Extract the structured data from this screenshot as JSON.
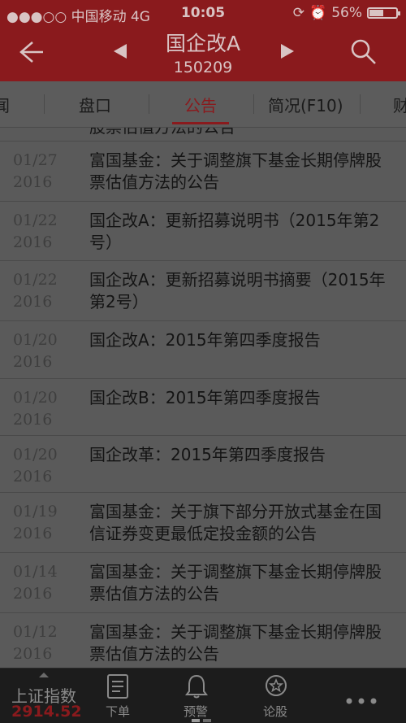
{
  "status_bar": {
    "carrier": "●●●○○ 中国移动  4G",
    "time": "10:05",
    "battery_percent": "56%",
    "battery_level": 0.56
  },
  "header": {
    "title": "国企改A",
    "code": "150209"
  },
  "tabs": [
    {
      "label": "闻",
      "active": false
    },
    {
      "label": "盘口",
      "active": false
    },
    {
      "label": "公告",
      "active": true
    },
    {
      "label": "简况(F10)",
      "active": false
    },
    {
      "label": "财",
      "active": false
    }
  ],
  "announcements": [
    {
      "date_md": "",
      "date_y": "",
      "title": "股票估值方法的公告"
    },
    {
      "date_md": "01/27",
      "date_y": "2016",
      "title": "富国基金：关于调整旗下基金长期停牌股票估值方法的公告"
    },
    {
      "date_md": "01/22",
      "date_y": "2016",
      "title": "国企改A：更新招募说明书（2015年第2号）"
    },
    {
      "date_md": "01/22",
      "date_y": "2016",
      "title": "国企改A：更新招募说明书摘要（2015年第2号）"
    },
    {
      "date_md": "01/20",
      "date_y": "2016",
      "title": "国企改A：2015年第四季度报告"
    },
    {
      "date_md": "01/20",
      "date_y": "2016",
      "title": "国企改B：2015年第四季度报告"
    },
    {
      "date_md": "01/20",
      "date_y": "2016",
      "title": "国企改革：2015年第四季度报告"
    },
    {
      "date_md": "01/19",
      "date_y": "2016",
      "title": "富国基金：关于旗下部分开放式基金在国信证券变更最低定投金额的公告"
    },
    {
      "date_md": "01/14",
      "date_y": "2016",
      "title": "富国基金：关于调整旗下基金长期停牌股票估值方法的公告"
    },
    {
      "date_md": "01/12",
      "date_y": "2016",
      "title": "富国基金：关于调整旗下基金长期停牌股票估值方法的公告"
    }
  ],
  "bottom_bar": {
    "index_name": "上证指数",
    "index_value": "2914.52",
    "items": [
      {
        "label": "下单",
        "icon": "document-icon"
      },
      {
        "label": "预警",
        "icon": "bell-icon"
      },
      {
        "label": "论股",
        "icon": "chat-star-icon"
      }
    ],
    "more_label": "●●●"
  },
  "colors": {
    "brand": "#8a1a1d",
    "overlay_background": "#5a5a5a"
  }
}
